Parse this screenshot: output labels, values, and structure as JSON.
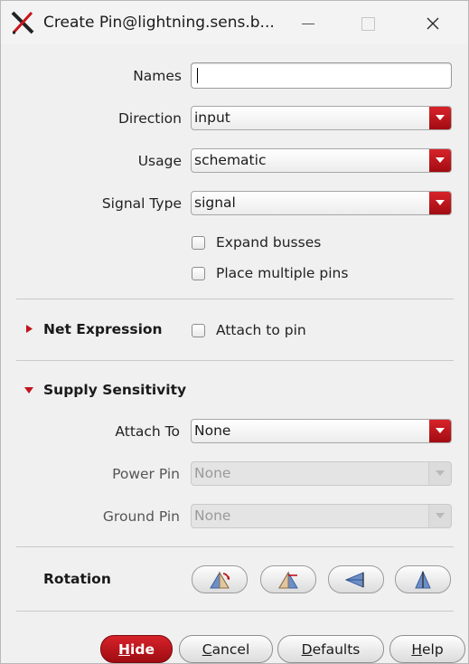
{
  "window": {
    "title": "Create Pin@lightning.sens.b...",
    "icon": "cadence-x-icon"
  },
  "form": {
    "names": {
      "label": "Names",
      "value": ""
    },
    "direction": {
      "label": "Direction",
      "value": "input"
    },
    "usage": {
      "label": "Usage",
      "value": "schematic"
    },
    "signal_type": {
      "label": "Signal Type",
      "value": "signal"
    },
    "expand_busses": {
      "label": "Expand busses",
      "checked": false
    },
    "place_multiple_pins": {
      "label": "Place multiple pins",
      "checked": false
    }
  },
  "net_expression": {
    "title": "Net Expression",
    "expanded": false,
    "attach_to_pin": {
      "label": "Attach to pin",
      "checked": false
    }
  },
  "supply_sensitivity": {
    "title": "Supply Sensitivity",
    "expanded": true,
    "attach_to": {
      "label": "Attach To",
      "value": "None"
    },
    "power_pin": {
      "label": "Power Pin",
      "value": "None",
      "enabled": false
    },
    "ground_pin": {
      "label": "Ground Pin",
      "value": "None",
      "enabled": false
    }
  },
  "rotation": {
    "title": "Rotation",
    "buttons": [
      "rotate-icon",
      "sideways-icon",
      "mirror-horizontal-icon",
      "mirror-vertical-icon"
    ]
  },
  "buttons": {
    "hide": {
      "u": "H",
      "rest": "ide"
    },
    "cancel": {
      "u": "C",
      "rest": "ancel"
    },
    "defaults": {
      "u": "D",
      "rest": "efaults"
    },
    "help": {
      "u": "H",
      "rest": "elp"
    }
  },
  "colors": {
    "accent": "#c0141b",
    "window_bg": "#f0f0f0"
  }
}
